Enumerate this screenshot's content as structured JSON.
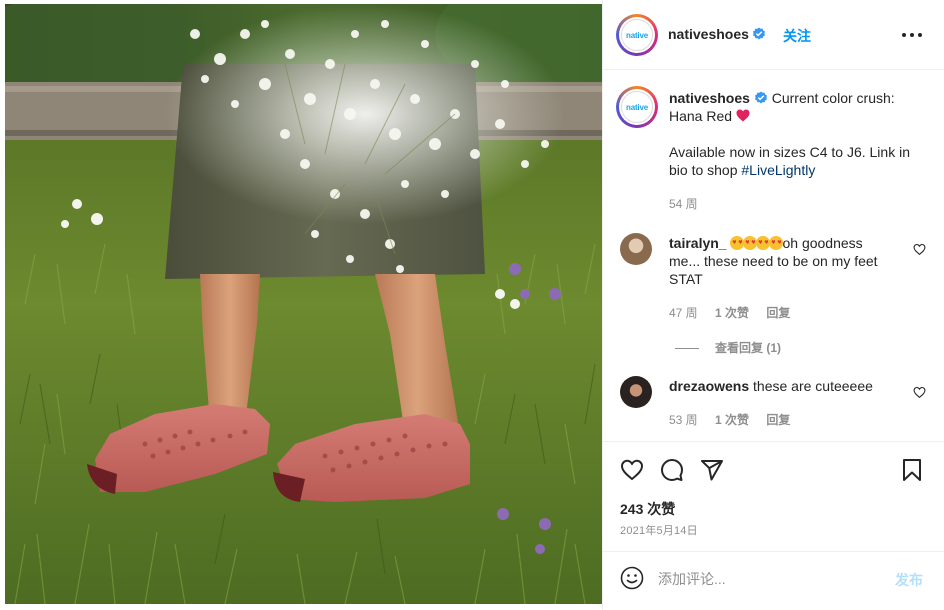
{
  "post": {
    "username": "nativeshoes",
    "avatar_text": "native",
    "follow_label": "关注",
    "caption_part1": "Current color crush: Hana Red",
    "caption_part2": "Available now in sizes C4 to J6. Link in bio to shop",
    "hashtag": "#LiveLightly",
    "caption_time": "54 周"
  },
  "comments": [
    {
      "username": "tairalyn_",
      "text": "oh goodness me... these need to be on my feet STAT",
      "emoji_count": 4,
      "time": "47 周",
      "likes": "1 次赞",
      "reply": "回复",
      "view_replies": "查看回复 (1)"
    },
    {
      "username": "drezaowens",
      "text": "these are cuteeeee",
      "time": "53 周",
      "likes": "1 次赞",
      "reply": "回复"
    }
  ],
  "actions": {
    "likes": "243 次赞",
    "date": "2021年5月14日"
  },
  "add_comment": {
    "placeholder": "添加评论...",
    "post_label": "发布"
  },
  "colors": {
    "accent": "#0095f6",
    "hashtag": "#00376b",
    "muted": "#8e8e8e",
    "post_disabled": "#b2dffc"
  },
  "icons": {
    "verified": "verified-badge-icon",
    "more": "more-options-icon",
    "heart": "heart-icon",
    "comment": "comment-icon",
    "share": "share-icon",
    "save": "bookmark-icon",
    "emoji": "smiley-icon"
  }
}
